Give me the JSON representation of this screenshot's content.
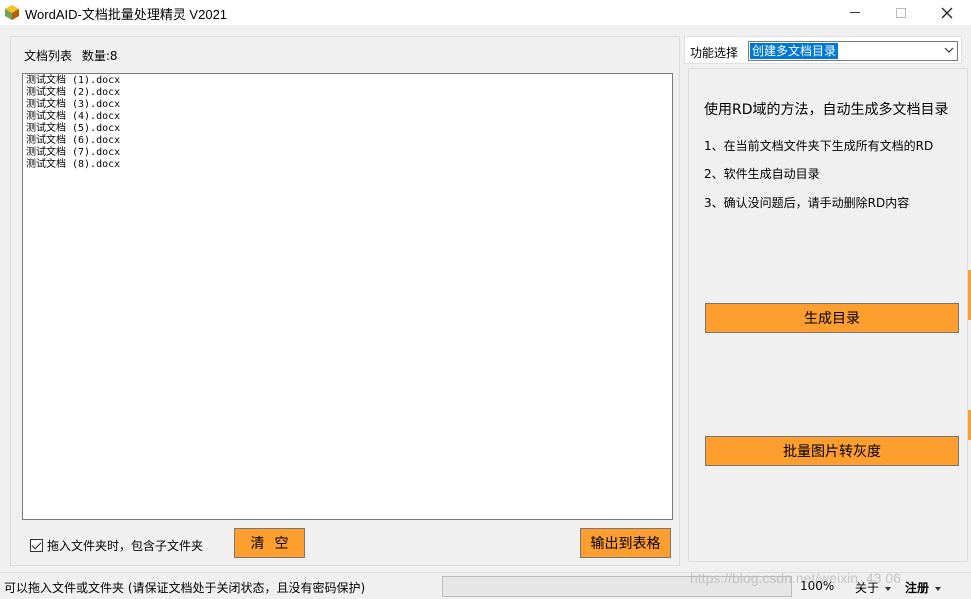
{
  "window": {
    "title": "WordAID-文档批量处理精灵 V2021",
    "minimize_glyph": "—",
    "maximize_glyph": "☐",
    "close_glyph": "✕"
  },
  "file_list": {
    "header_label": "文档列表",
    "count_label": "数量:",
    "count": "8",
    "items": [
      "测试文档 (1).docx",
      "测试文档 (2).docx",
      "测试文档 (3).docx",
      "测试文档 (4).docx",
      "测试文档 (5).docx",
      "测试文档 (6).docx",
      "测试文档 (7).docx",
      "测试文档 (8).docx"
    ],
    "include_subfolders_label": "拖入文件夹时，包含子文件夹",
    "include_subfolders_checked": true,
    "clear_button": "清空",
    "export_button": "输出到表格"
  },
  "function_panel": {
    "label": "功能选择",
    "selected": "创建多文档目录",
    "description_title": "使用RD域的方法，自动生成多文档目录",
    "steps": [
      "1、在当前文档文件夹下生成所有文档的RD",
      "2、软件生成自动目录",
      "3、确认没问题后，请手动删除RD内容"
    ],
    "generate_button": "生成目录",
    "grayscale_button": "批量图片转灰度"
  },
  "status_bar": {
    "text": "可以拖入文件或文件夹 (请保证文档处于关闭状态，且没有密码保护)",
    "zoom": "100%",
    "about_menu": "关于",
    "register_menu": "注册",
    "watermark": "https://blog.csdn.net/weixin_43 06"
  },
  "colors": {
    "accent_button": "#fe9e2f",
    "selection": "#0078d7"
  },
  "icons": {
    "app": "app-icon",
    "dropdown": "chevron-down-icon",
    "checkbox": "checkmark-icon"
  }
}
